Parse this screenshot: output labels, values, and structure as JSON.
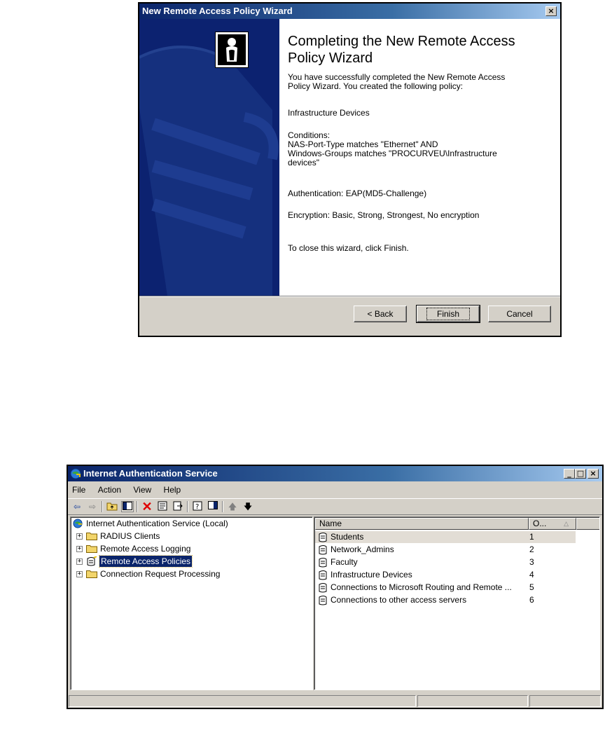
{
  "wizard": {
    "title": "New Remote Access Policy Wizard",
    "heading": "Completing the New Remote Access Policy Wizard",
    "intro": "You have successfully completed the New Remote Access\nPolicy Wizard. You created the following policy:",
    "policy_name": "Infrastructure Devices",
    "conditions": "Conditions:\n    NAS-Port-Type matches \"Ethernet\" AND\n    Windows-Groups matches \"PROCURVEU\\Infrastructure\ndevices\"",
    "authentication": "Authentication: EAP(MD5-Challenge)",
    "encryption": "Encryption: Basic, Strong, Strongest, No encryption",
    "close_hint": "To close this wizard, click Finish.",
    "back_label": "< Back",
    "finish_label": "Finish",
    "cancel_label": "Cancel",
    "close_glyph": "×"
  },
  "ias": {
    "title": "Internet Authentication Service",
    "window_buttons": {
      "minimize": "_",
      "maximize": "□",
      "close": "×"
    },
    "menu": [
      {
        "label": "File"
      },
      {
        "label": "Action"
      },
      {
        "label": "View"
      },
      {
        "label": "Help"
      }
    ],
    "toolbar_icons": [
      "back-arrow-icon",
      "forward-arrow-icon",
      "up-folder-icon",
      "show-hide-tree-icon",
      "delete-icon",
      "properties-icon",
      "export-list-icon",
      "help-icon",
      "show-hide-action-pane-icon",
      "move-up-icon",
      "move-down-icon"
    ],
    "tree": {
      "root": "Internet Authentication Service (Local)",
      "nodes": [
        {
          "label": "RADIUS Clients"
        },
        {
          "label": "Remote Access Logging"
        },
        {
          "label": "Remote Access Policies",
          "selected": true
        },
        {
          "label": "Connection Request Processing"
        }
      ]
    },
    "list": {
      "columns": [
        {
          "label": "Name"
        },
        {
          "label": "O...",
          "sort": "ascending"
        }
      ],
      "rows": [
        {
          "name": "Students",
          "order": "1",
          "selected": true
        },
        {
          "name": "Network_Admins",
          "order": "2"
        },
        {
          "name": "Faculty",
          "order": "3"
        },
        {
          "name": "Infrastructure Devices",
          "order": "4"
        },
        {
          "name": "Connections to Microsoft Routing and Remote ...",
          "order": "5"
        },
        {
          "name": "Connections to other access servers",
          "order": "6"
        }
      ]
    }
  },
  "colors": {
    "title_bar": "#0a246a",
    "chrome": "#d4d0c8",
    "wizard_side": "#0c2270",
    "selection": "#0a246a"
  }
}
